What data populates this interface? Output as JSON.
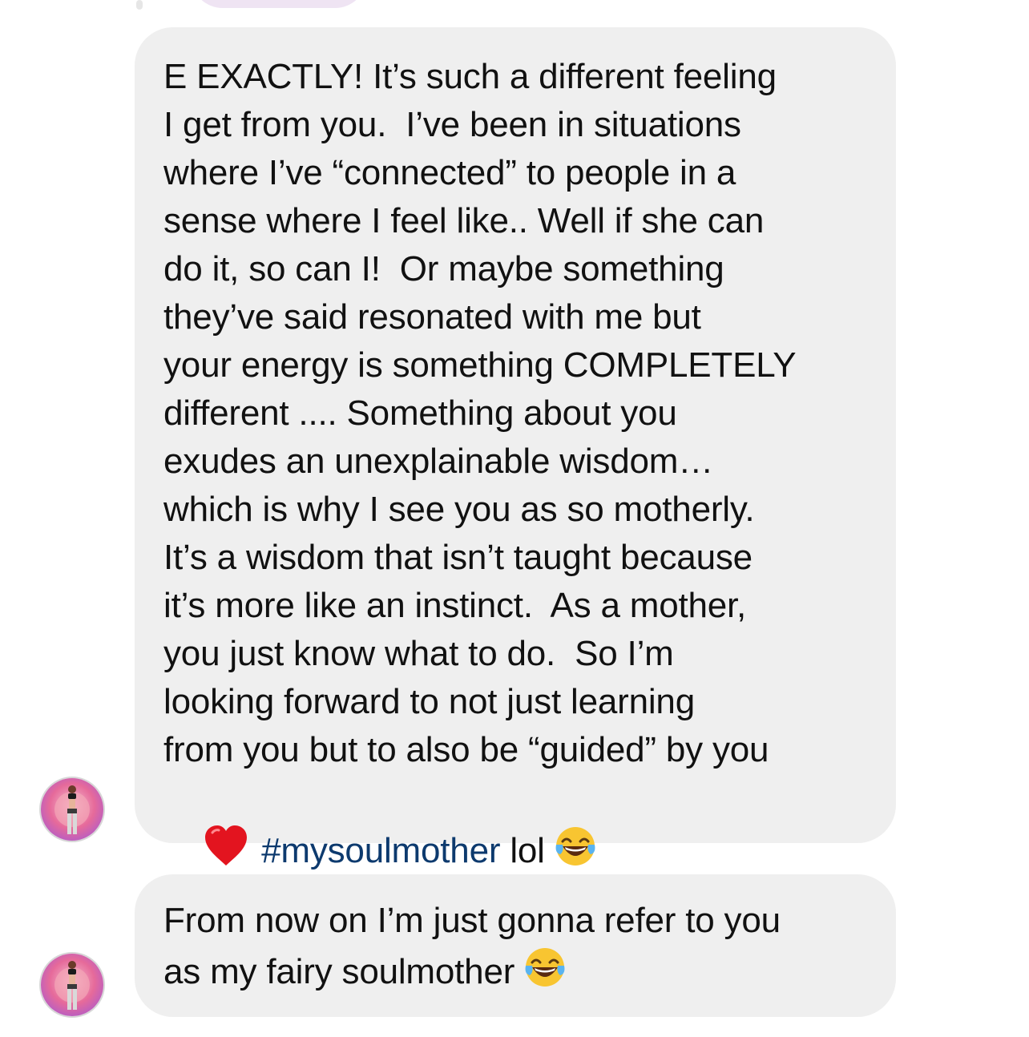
{
  "conversation": {
    "messages": [
      {
        "lines": [
          "E EXACTLY! It’s such a different feeling",
          "I get from you.  I’ve been in situations",
          "where I’ve “connected” to people in a",
          "sense where I feel like.. Well if she can",
          "do it, so can I!  Or maybe something",
          "they’ve said resonated with me but",
          "your energy is something COMPLETELY",
          "different .... Something about you",
          "exudes an unexplainable wisdom…",
          "which is why I see you as so motherly.",
          "It’s a wisdom that isn’t taught because",
          "it’s more like an instinct.  As a mother,",
          "you just know what to do.  So I’m",
          "looking forward to not just learning",
          "from you but to also be “guided” by you"
        ],
        "last_line": {
          "heart_icon": "red-heart-emoji",
          "hashtag": "#mysoulmother",
          "text_after": " lol",
          "emoji_icon": "face-with-tears-of-joy-emoji"
        }
      },
      {
        "lines": [
          "From now on I’m just gonna refer to you",
          "as my fairy soulmother"
        ],
        "emoji_icon": "face-with-tears-of-joy-emoji"
      }
    ]
  },
  "colors": {
    "bubble_background": "#efefef",
    "text": "#111111",
    "hashtag": "#0d3a6e",
    "page_background": "#ffffff"
  }
}
